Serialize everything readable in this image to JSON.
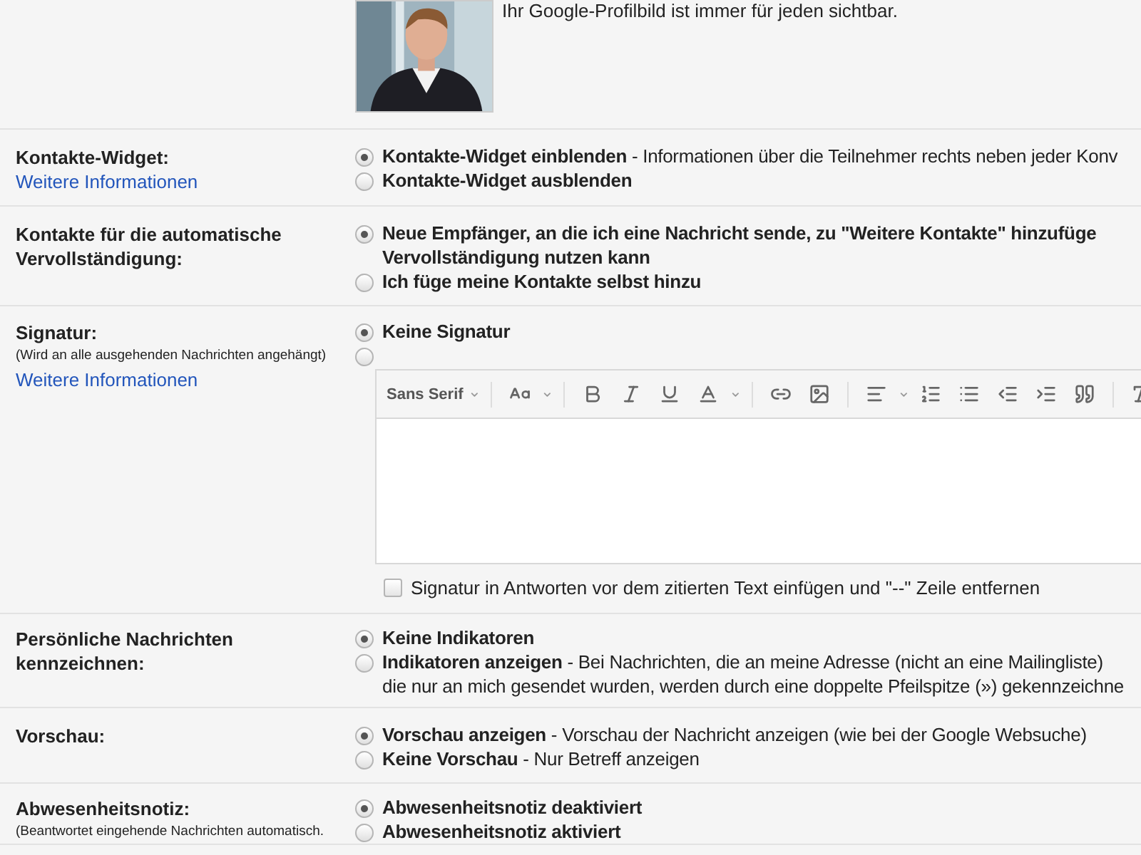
{
  "profile": {
    "caption": "Ihr Google-Profilbild ist immer für jeden sichtbar."
  },
  "settings": [
    {
      "kind": "radio",
      "label": "Kontakte-Widget:",
      "link": "Weitere Informationen",
      "options": [
        {
          "label": "Kontakte-Widget einblenden",
          "description": "- Informationen über die Teilnehmer rechts neben jeder Konv",
          "selected": true
        },
        {
          "label": "Kontakte-Widget ausblenden",
          "selected": false
        }
      ]
    },
    {
      "kind": "radio",
      "label": "Kontakte für die automatische\nVervollständigung:",
      "options": [
        {
          "label": "Neue Empfänger, an die ich eine Nachricht sende, zu \"Weitere Kontakte\" hinzufüge\nVervollständigung nutzen kann",
          "selected": true
        },
        {
          "label": "Ich füge meine Kontakte selbst hinzu",
          "selected": false
        }
      ]
    },
    {
      "kind": "signature",
      "label": "Signatur:",
      "note": "(Wird an alle ausgehenden Nachrichten angehängt)",
      "link": "Weitere Informationen",
      "options": [
        {
          "kind": "text",
          "label": "Keine Signatur",
          "selected": true
        },
        {
          "kind": "editor",
          "selected": false
        }
      ],
      "editor": {
        "font": "Sans Serif"
      },
      "append_option": {
        "label": "Signatur in Antworten vor dem zitierten Text einfügen und \"--\" Zeile entfernen",
        "checked": false
      }
    },
    {
      "kind": "radio",
      "label": "Persönliche Nachrichten\nkennzeichnen:",
      "options": [
        {
          "label": "Keine Indikatoren",
          "selected": true
        },
        {
          "label": "Indikatoren anzeigen",
          "description": "- Bei Nachrichten, die an meine Adresse (nicht an eine Mailingliste)\ndie nur an mich gesendet wurden, werden durch eine doppelte Pfeilspitze (») gekennzeichne",
          "selected": false
        }
      ]
    },
    {
      "kind": "radio",
      "label": "Vorschau:",
      "options": [
        {
          "label": "Vorschau anzeigen",
          "description": "- Vorschau der Nachricht anzeigen (wie bei der Google Websuche)",
          "selected": true
        },
        {
          "label": "Keine Vorschau",
          "description": "- Nur Betreff anzeigen",
          "selected": false
        }
      ]
    },
    {
      "kind": "radio",
      "label": "Abwesenheitsnotiz:",
      "note": "(Beantwortet eingehende Nachrichten automatisch.",
      "options": [
        {
          "label": "Abwesenheitsnotiz deaktiviert",
          "selected": true
        },
        {
          "label": "Abwesenheitsnotiz aktiviert",
          "selected": false
        }
      ]
    }
  ]
}
